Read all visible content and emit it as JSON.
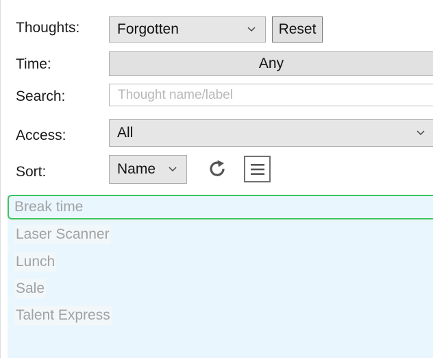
{
  "filters": {
    "thoughts": {
      "label": "Thoughts:",
      "selected": "Forgotten",
      "reset_label": "Reset"
    },
    "time": {
      "label": "Time:",
      "value": "Any"
    },
    "search": {
      "label": "Search:",
      "value": "",
      "placeholder": "Thought name/label"
    },
    "access": {
      "label": "Access:",
      "selected": "All"
    },
    "sort": {
      "label": "Sort:",
      "selected": "Name"
    }
  },
  "icons": {
    "refresh": "refresh-icon",
    "menu": "menu-icon"
  },
  "colors": {
    "list_background": "#eaf6fd",
    "selection_border": "#3cc45c",
    "item_text": "#a2a2a2",
    "control_background": "#e6e6e6"
  },
  "list": {
    "items": [
      "Break time",
      "Laser Scanner",
      "Lunch",
      "Sale",
      "Talent Express"
    ],
    "selected_index": 0
  }
}
